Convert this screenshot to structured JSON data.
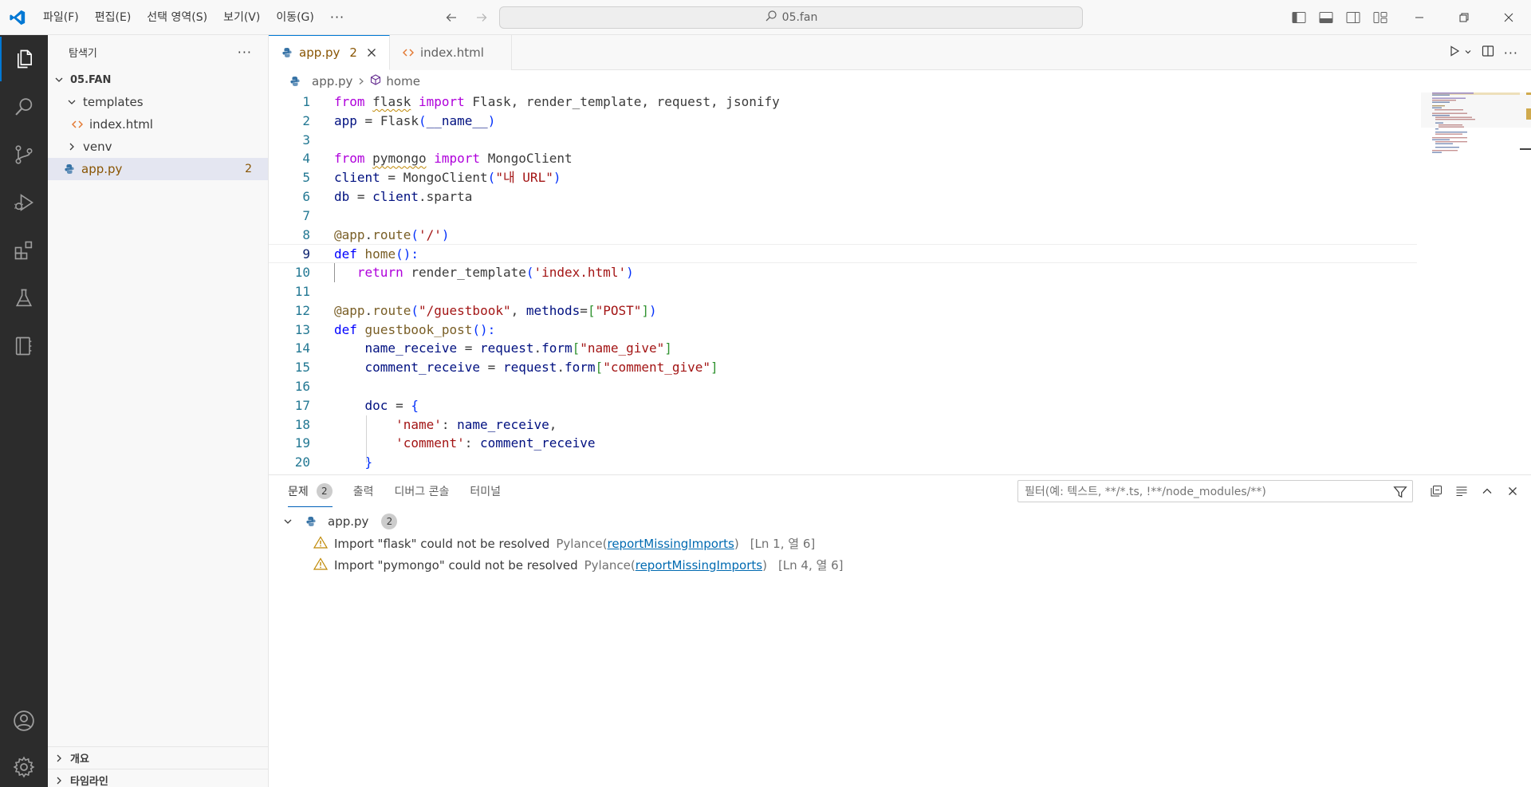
{
  "menu": {
    "items": [
      "파일(F)",
      "편집(E)",
      "선택 영역(S)",
      "보기(V)",
      "이동(G)"
    ],
    "more": "···"
  },
  "command_center": {
    "text": "05.fan"
  },
  "sidebar": {
    "title": "탐색기",
    "more": "···",
    "root": "05.FAN",
    "tree": {
      "templates": "templates",
      "index_html": "index.html",
      "venv": "venv",
      "app_py": "app.py",
      "app_py_badge": "2"
    },
    "outline": "개요",
    "timeline": "타임라인"
  },
  "tabs": {
    "active": {
      "label": "app.py",
      "count": "2"
    },
    "second": {
      "label": "index.html"
    }
  },
  "breadcrumb": {
    "file": "app.py",
    "symbol": "home"
  },
  "line_numbers": [
    "1",
    "2",
    "3",
    "4",
    "5",
    "6",
    "7",
    "8",
    "9",
    "10",
    "11",
    "12",
    "13",
    "14",
    "15",
    "16",
    "17",
    "18",
    "19",
    "20"
  ],
  "code": {
    "l1": {
      "from": "from",
      "mod": "flask",
      "imp": "import",
      "rest": "Flask, render_template, request, jsonify"
    },
    "l2": {
      "a": "app",
      "eq": " = ",
      "fn": "Flask",
      "p1": "(",
      "arg": "__name__",
      "p2": ")"
    },
    "l4": {
      "from": "from",
      "mod": "pymongo",
      "imp": "import",
      "cls": "MongoClient"
    },
    "l5": {
      "a": "client",
      "eq": " = ",
      "fn": "MongoClient",
      "p1": "(",
      "str": "\"내 URL\"",
      "p2": ")"
    },
    "l6": {
      "a": "db",
      "eq": " = ",
      "b": "client",
      "dot": ".",
      "c": "sparta"
    },
    "l8": {
      "at": "@",
      "a": "app",
      "dot": ".",
      "fn": "route",
      "p1": "(",
      "str": "'/'",
      "p2": ")"
    },
    "l9": {
      "def": "def",
      "fn": "home",
      "p": "():"
    },
    "l10": {
      "ret": "return",
      "fn": "render_template",
      "p1": "(",
      "str": "'index.html'",
      "p2": ")"
    },
    "l12": {
      "at": "@",
      "a": "app",
      "dot": ".",
      "fn": "route",
      "p1": "(",
      "str": "\"/guestbook\"",
      "comma": ", ",
      "kwarg": "methods",
      "eq": "=",
      "b1": "[",
      "str2": "\"POST\"",
      "b2": "]",
      "p2": ")"
    },
    "l13": {
      "def": "def",
      "fn": "guestbook_post",
      "p": "():"
    },
    "l14": {
      "a": "name_receive",
      "eq": " = ",
      "b": "request",
      "dot": ".",
      "c": "form",
      "b1": "[",
      "str": "\"name_give\"",
      "b2": "]"
    },
    "l15": {
      "a": "comment_receive",
      "eq": " = ",
      "b": "request",
      "dot": ".",
      "c": "form",
      "b1": "[",
      "str": "\"comment_give\"",
      "b2": "]"
    },
    "l17": {
      "a": "doc",
      "eq": " = ",
      "b": "{"
    },
    "l18": {
      "str": "'name'",
      "colon": ": ",
      "v": "name_receive",
      "comma": ","
    },
    "l19": {
      "str": "'comment'",
      "colon": ": ",
      "v": "comment_receive"
    },
    "l20": {
      "b": "}"
    }
  },
  "panel": {
    "tabs": {
      "problems": "문제",
      "problems_count": "2",
      "output": "출력",
      "debug": "디버그 콘솔",
      "terminal": "터미널"
    },
    "filter_placeholder": "필터(예: 텍스트, **/*.ts, !**/node_modules/**)",
    "problems": {
      "file": "app.py",
      "count": "2",
      "items": [
        {
          "message": "Import \"flask\" could not be resolved",
          "source": "Pylance",
          "code": "reportMissingImports",
          "location": "[Ln 1, 열 6]"
        },
        {
          "message": "Import \"pymongo\" could not be resolved",
          "source": "Pylance",
          "code": "reportMissingImports",
          "location": "[Ln 4, 열 6]"
        }
      ]
    }
  },
  "colors": {
    "accent": "#0078d4",
    "warning": "#bf8803",
    "activitybar": "#2c2c2c"
  }
}
